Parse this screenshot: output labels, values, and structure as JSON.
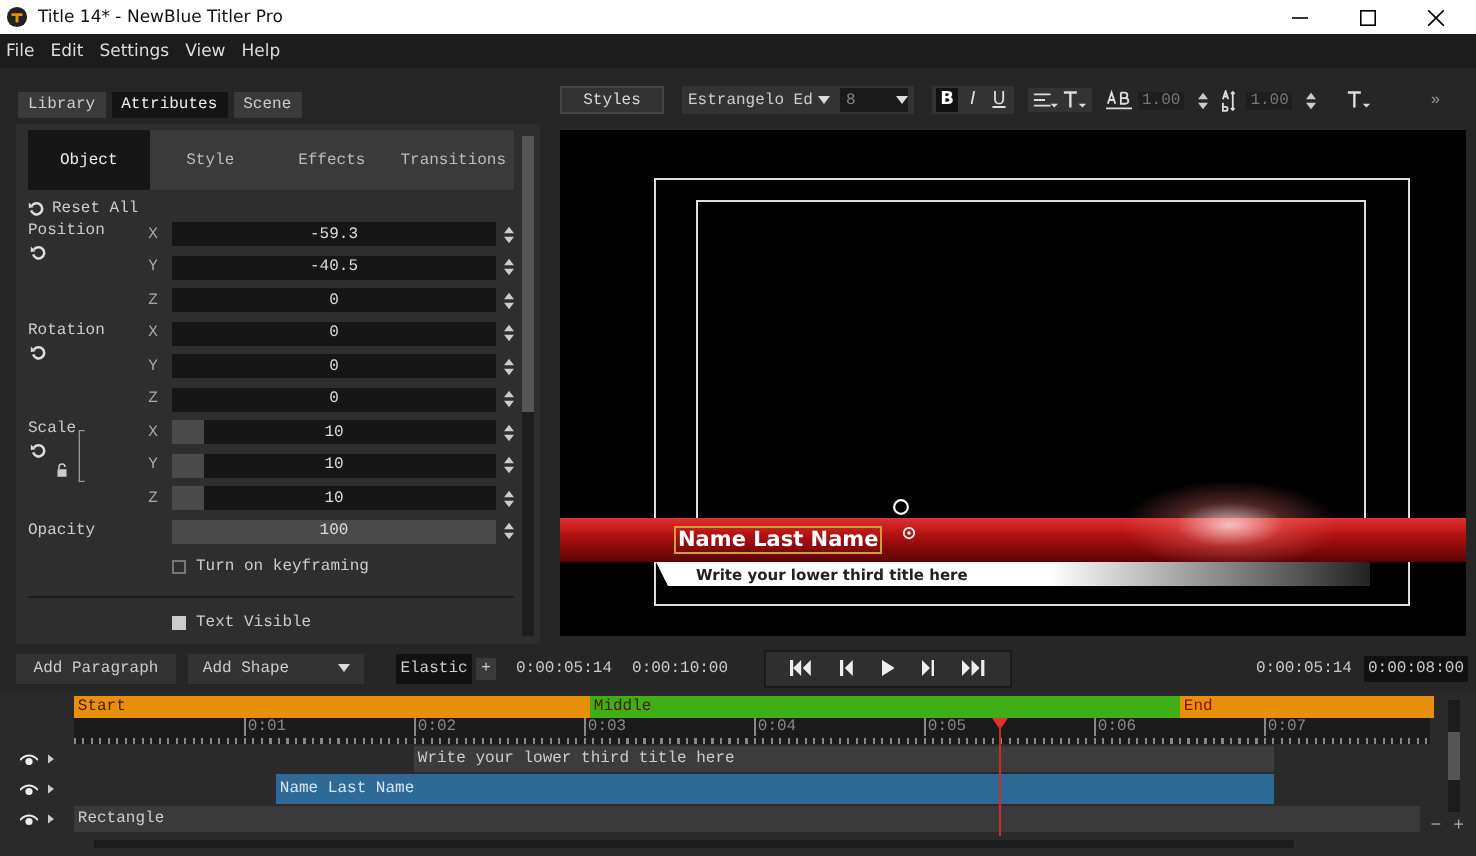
{
  "window": {
    "title": "Title 14* - NewBlue Titler Pro"
  },
  "menu": [
    "File",
    "Edit",
    "Settings",
    "View",
    "Help"
  ],
  "panel_tabs": [
    {
      "label": "Library",
      "selected": false
    },
    {
      "label": "Attributes",
      "selected": true
    },
    {
      "label": "Scene",
      "selected": false
    }
  ],
  "attribute_tabs": [
    {
      "label": "Object",
      "selected": true
    },
    {
      "label": "Style",
      "selected": false
    },
    {
      "label": "Effects",
      "selected": false
    },
    {
      "label": "Transitions",
      "selected": false
    }
  ],
  "reset_all": "Reset All",
  "property_groups": [
    {
      "label": "Position",
      "kind": "plain",
      "rows": [
        {
          "axis": "X",
          "value": "-59.3"
        },
        {
          "axis": "Y",
          "value": "-40.5"
        },
        {
          "axis": "Z",
          "value": "0"
        }
      ]
    },
    {
      "label": "Rotation",
      "kind": "plain",
      "rows": [
        {
          "axis": "X",
          "value": "0"
        },
        {
          "axis": "Y",
          "value": "0"
        },
        {
          "axis": "Z",
          "value": "0"
        }
      ]
    },
    {
      "label": "Scale",
      "kind": "linked",
      "rows": [
        {
          "axis": "X",
          "value": "10",
          "level": 0.1
        },
        {
          "axis": "Y",
          "value": "10",
          "level": 0.1
        },
        {
          "axis": "Z",
          "value": "10",
          "level": 0.1
        }
      ]
    }
  ],
  "opacity": {
    "label": "Opacity",
    "value": "100",
    "level": 1
  },
  "keyframing": {
    "label": "Turn on keyframing",
    "checked": false
  },
  "text_visible": {
    "label": "Text Visible",
    "checked": true
  },
  "toolbar": {
    "styles": "Styles",
    "font": "Estrangelo Ed",
    "size": "8",
    "format_buttons": [
      {
        "label": "B",
        "selected": true
      },
      {
        "label": "I",
        "selected": false
      },
      {
        "label": "U",
        "selected": false
      }
    ],
    "tracking": "1.00",
    "leading": "1.00",
    "more": "»"
  },
  "preview": {
    "name": "Name Last Name",
    "subtitle": "Write your lower third title here"
  },
  "bottom_bar": {
    "add_paragraph": "Add Paragraph",
    "add_shape": "Add Shape",
    "elastic": "Elastic",
    "add": "+",
    "current_time": "0:00:05:14",
    "duration": "0:00:10:00",
    "playhead_time": "0:00:05:14",
    "end_time": "0:00:08:00"
  },
  "timeline": {
    "sections": [
      {
        "label": "Start",
        "color": "#e8900c"
      },
      {
        "label": "Middle",
        "color": "#3fae17"
      },
      {
        "label": "End",
        "color": "#e8900c"
      }
    ],
    "ruler": [
      "0:01",
      "0:02",
      "0:03",
      "0:04",
      "0:05",
      "0:06",
      "0:07"
    ],
    "tracks": [
      {
        "label": "Write your lower third title here",
        "kind": "text"
      },
      {
        "label": "Name Last Name",
        "kind": "name"
      },
      {
        "label": "Rectangle",
        "kind": "shape"
      }
    ],
    "zoom_out": "−",
    "zoom_in": "+"
  }
}
